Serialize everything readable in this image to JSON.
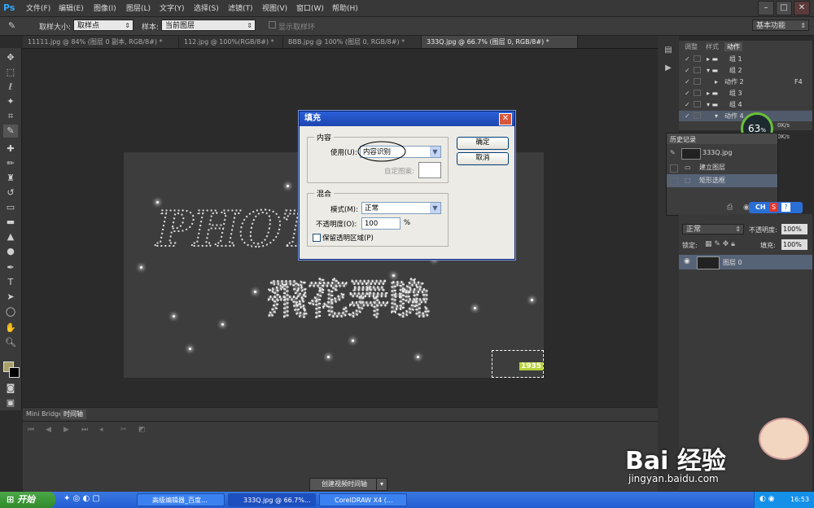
{
  "app": {
    "logo": "Ps"
  },
  "menu": [
    "文件(F)",
    "编辑(E)",
    "图像(I)",
    "图层(L)",
    "文字(Y)",
    "选择(S)",
    "滤镜(T)",
    "视图(V)",
    "窗口(W)",
    "帮助(H)"
  ],
  "window_controls": [
    "–",
    "□",
    "✕"
  ],
  "options": {
    "sample_size_label": "取样大小:",
    "sample_size_value": "取样点",
    "sample_label": "样本:",
    "sample_value": "当前图层",
    "show_ring_label": "显示取样环",
    "workspace": "基本功能"
  },
  "doc_tabs": [
    "11111.jpg @ 84% (图层 0 副本, RGB/8#) *",
    "112.jpg @ 100%(RGB/8#) *",
    "BBB.jpg @ 100% (图层 0, RGB/8#) *",
    "333Q.jpg @ 66.7% (图层 0, RGB/8#) *"
  ],
  "canvas": {
    "text_top": "PHOTO",
    "text_bottom": "飛花弄晚",
    "corner_logo": "1935"
  },
  "dialog": {
    "title": "填充",
    "close": "✕",
    "content_group": "内容",
    "use_label": "使用(U):",
    "use_value": "内容识别",
    "custom_pattern_label": "自定图案:",
    "blend_group": "混合",
    "mode_label": "模式(M):",
    "mode_value": "正常",
    "opacity_label": "不透明度(O):",
    "opacity_value": "100",
    "opacity_unit": "%",
    "preserve_label": "保留透明区域(P)",
    "ok": "确定",
    "cancel": "取消"
  },
  "bottom_panel": {
    "tabs": [
      "Mini Bridge",
      "时间轴"
    ],
    "create_video_button": "创建视频时间轴"
  },
  "actions_panel": {
    "tabs": [
      "调整",
      "样式",
      "动作"
    ],
    "rows": [
      {
        "label": "组 1",
        "type": "folder"
      },
      {
        "label": "组 2",
        "type": "folder-open"
      },
      {
        "label": "动作 2",
        "type": "action",
        "shortcut": "F4"
      },
      {
        "label": "组 3",
        "type": "folder"
      },
      {
        "label": "组 4",
        "type": "folder-open"
      },
      {
        "label": "动作 4",
        "type": "action",
        "shortcut": ""
      }
    ]
  },
  "cpu_widget": {
    "percent": "63",
    "unit": "%",
    "up": "0K/s",
    "down": "0K/s"
  },
  "history_panel": {
    "title": "历史记录",
    "snapshot": "333Q.jpg",
    "items": [
      "建立图层",
      "矩形选框"
    ]
  },
  "ime_bar": {
    "lang": "CH",
    "items": [
      "S",
      "?"
    ]
  },
  "layers_panel": {
    "blend_mode": "正常",
    "opacity_label": "不透明度:",
    "opacity_value": "100%",
    "lock_label": "锁定:",
    "fill_label": "填充:",
    "fill_value": "100%",
    "layer_name": "图层 0"
  },
  "taskbar": {
    "start": "开始",
    "tasks": [
      "高级编辑器_百度...",
      "333Q.jpg @ 66.7%...",
      "CorelDRAW X4 (..."
    ],
    "clock": "16:53"
  },
  "watermark": {
    "brand": "Bai 经验",
    "url": "jingyan.baidu.com"
  }
}
